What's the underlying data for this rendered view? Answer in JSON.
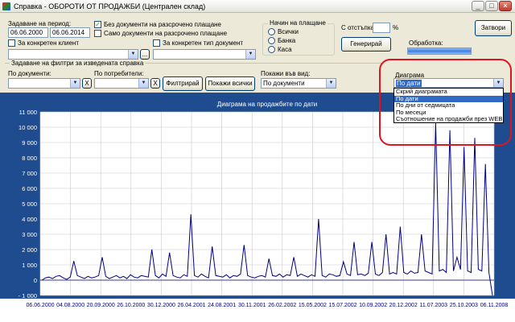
{
  "window": {
    "title": "Справка - ОБОРОТИ ОТ ПРОДАЖБИ (Централен склад)",
    "min": "_",
    "max": "□",
    "close": "×"
  },
  "period": {
    "label": "Задаване на период:",
    "from": "06.06.2000",
    "to": "06.06.2014"
  },
  "options": {
    "no_installment": "Без документи на разсрочено плащане",
    "only_installment": "Само документи на разсрочено плащане",
    "client_label": "За конкретен клиент",
    "doc_type_label": "За конкретен тип документ",
    "browse_label": "..."
  },
  "payment": {
    "title": "Начин на плащане",
    "all": "Всички",
    "bank": "Банка",
    "cash": "Каса"
  },
  "discount": {
    "label": "С отстъпка:",
    "value": "",
    "unit": "%"
  },
  "generate_label": "Генерирай",
  "processing_label": "Обработка:",
  "close_label": "Затвори",
  "filters": {
    "title": "Задаване на филтри за изведената справка",
    "by_documents": "По документи:",
    "by_users": "По потребители:",
    "clear_label": "X",
    "filter_label": "Филтрирай",
    "show_all_label": "Покажи всички",
    "view_label": "Покажи във вид:",
    "view_value": "По документи"
  },
  "diagram": {
    "label": "Диаграма",
    "value": "По дати",
    "options": [
      "Скрий диаграмата",
      "По дати",
      "По дни от седмицата",
      "По месеци",
      "Съотношение на продажби през WEB"
    ],
    "selected_index": 1
  },
  "chart_data": {
    "type": "line",
    "title": "Диаграма на продажбите по дати",
    "xlabel": "",
    "ylabel": "",
    "ylim": [
      -1000,
      11000
    ],
    "yticks": [
      "11 000",
      "10 000",
      "9 000",
      "8 000",
      "7 000",
      "6 000",
      "5 000",
      "4 000",
      "3 000",
      "2 000",
      "1 000",
      "0",
      "- 1 000"
    ],
    "xticks": [
      "06.06.2000",
      "04.08.2000",
      "20.09.2000",
      "26.10.2000",
      "30.12.2000",
      "26.04.2001",
      "24.08.2001",
      "30.11.2001",
      "26.02.2002",
      "15.05.2002",
      "15.07.2002",
      "10.09.2002",
      "20.12.2002",
      "11.07.2003",
      "25.10.2003",
      "06.11.2008"
    ],
    "series": [
      {
        "values": [
          0,
          150,
          200,
          100,
          250,
          300,
          150,
          50,
          200,
          1250,
          300,
          200,
          100,
          250,
          150,
          200,
          300,
          1500,
          250,
          100,
          200,
          300,
          150,
          250,
          100,
          350,
          200,
          150,
          300,
          250,
          200,
          2000,
          300,
          150,
          400,
          250,
          1800,
          300,
          200,
          150,
          350,
          250,
          4300,
          300,
          200,
          400,
          250,
          150,
          2200,
          300,
          250,
          200,
          350,
          150,
          300,
          250,
          400,
          2300,
          300,
          200,
          150,
          250,
          300,
          200,
          1400,
          300,
          250,
          400,
          200,
          350,
          300,
          1500,
          250,
          400,
          300,
          200,
          350,
          250,
          4000,
          300,
          200,
          400,
          350,
          250,
          300,
          1200,
          400,
          300,
          2500,
          350,
          400,
          300,
          450,
          2500,
          400,
          300,
          500,
          3000,
          400,
          500,
          400,
          3500,
          500,
          400,
          600,
          450,
          500,
          3000,
          600,
          500,
          400,
          10300,
          600,
          700,
          500,
          9800,
          600,
          1500,
          700,
          8700,
          600,
          500,
          9300,
          700,
          600,
          7600,
          500,
          -1000
        ]
      }
    ],
    "grid": true,
    "legend": "none"
  }
}
